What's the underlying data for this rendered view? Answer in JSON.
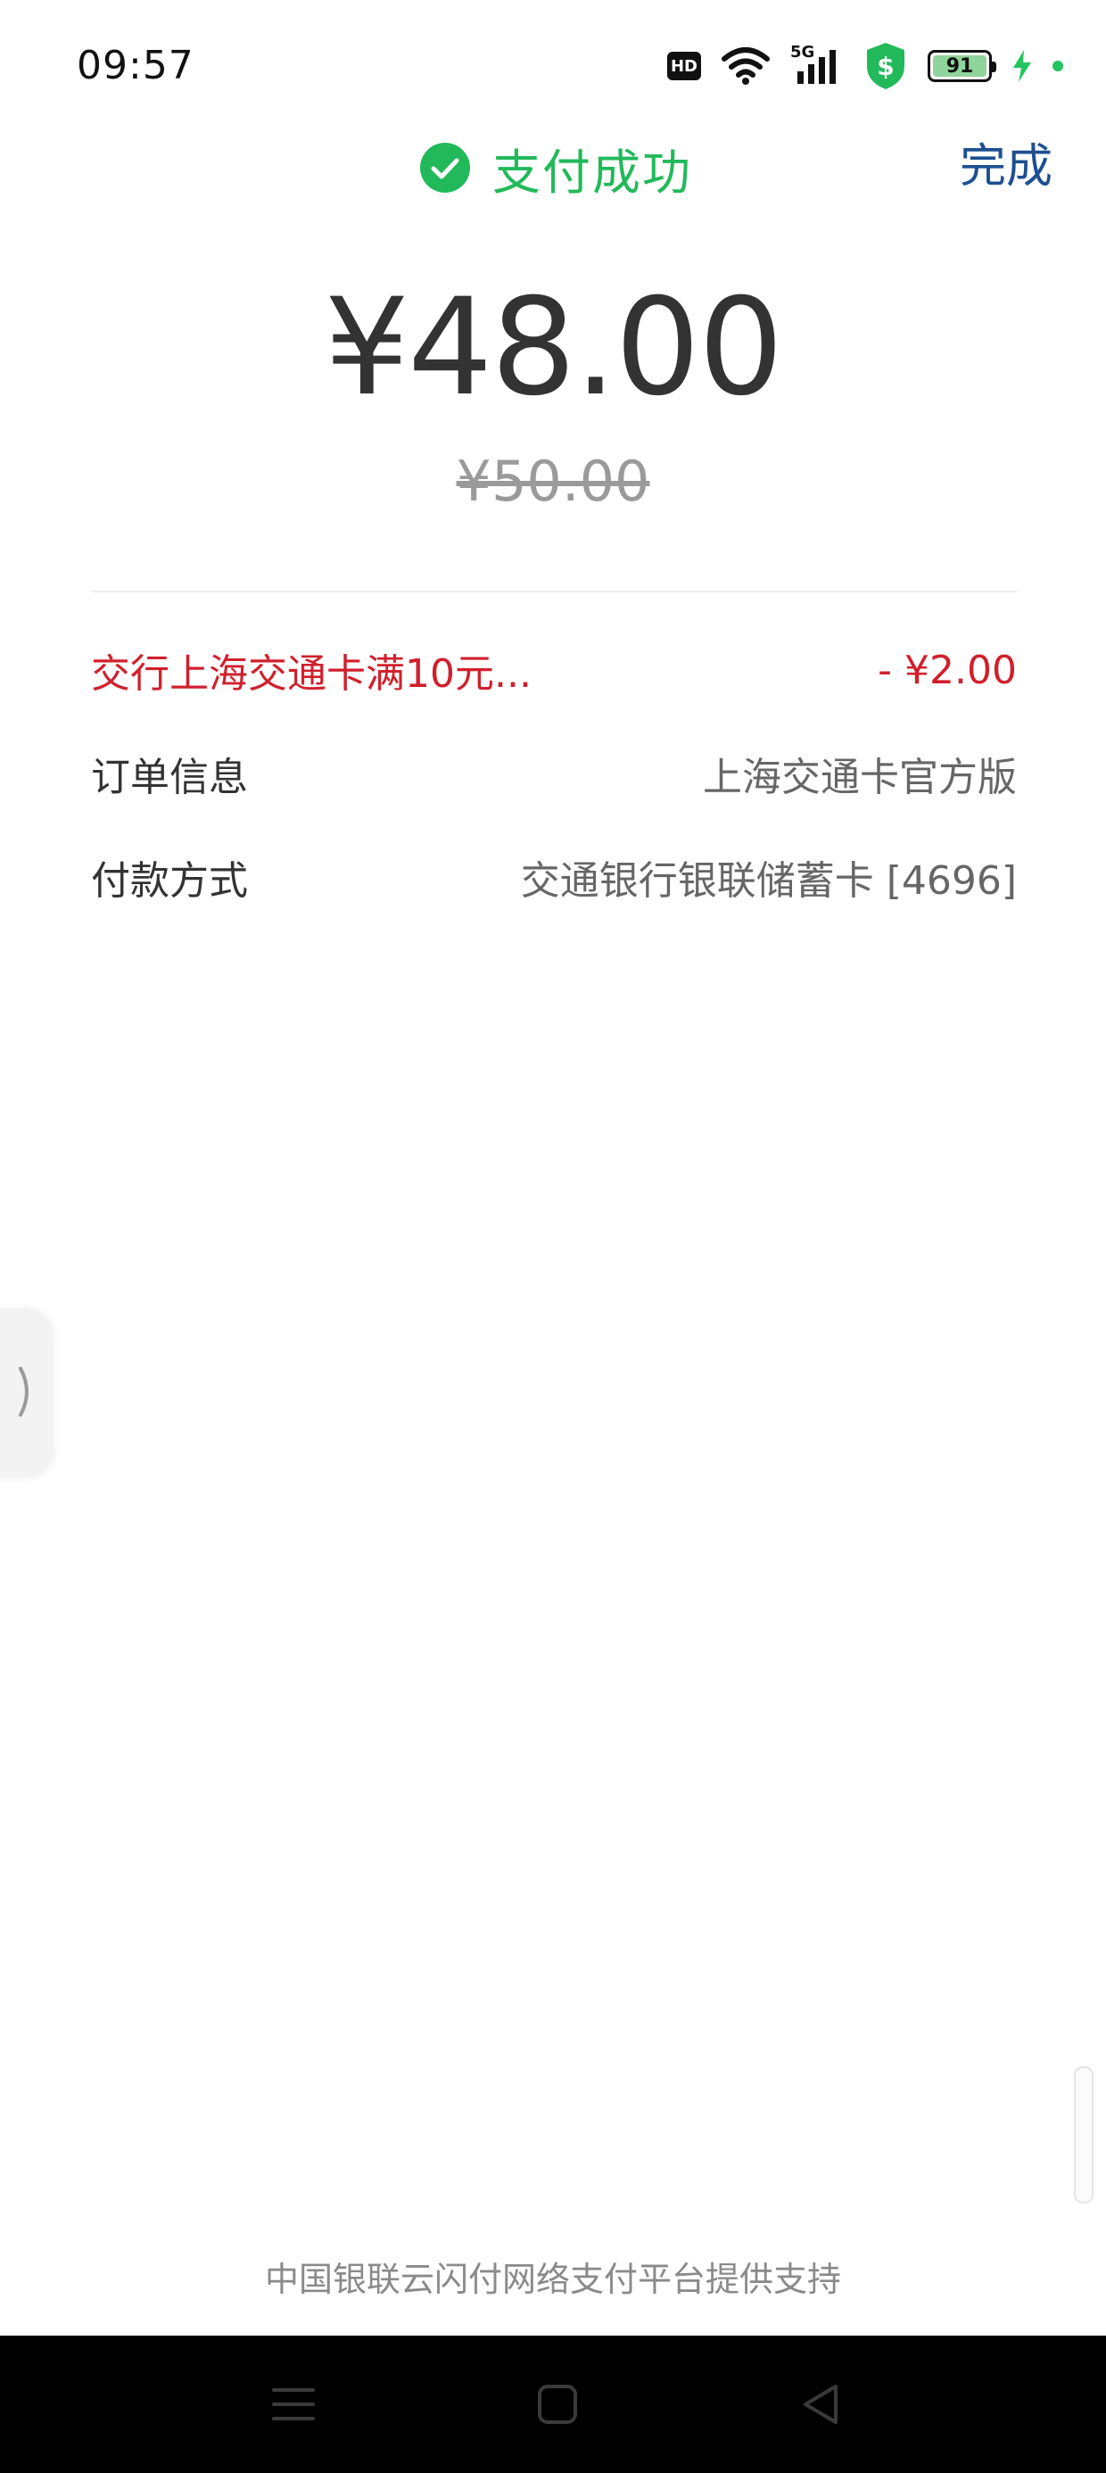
{
  "status_bar": {
    "time": "09:57",
    "hd_label": "HD",
    "network_label": "5G",
    "battery_level": "91"
  },
  "header": {
    "title": "支付成功",
    "done_label": "完成",
    "accent_color": "#22b95a",
    "link_color": "#1d4f91"
  },
  "payment": {
    "paid_amount": "¥48.00",
    "original_amount": "¥50.00"
  },
  "details": {
    "discount": {
      "label": "交行上海交通卡满10元...",
      "value": "- ¥2.00",
      "color": "#d0202c"
    },
    "order_info": {
      "label": "订单信息",
      "value": "上海交通卡官方版"
    },
    "payment_method": {
      "label": "付款方式",
      "value": "交通银行银联储蓄卡 [4696]"
    }
  },
  "footer": {
    "note": "中国银联云闪付网络支付平台提供支持"
  },
  "icons": {
    "success": "check-circle-icon",
    "side_handle": "chevron-right-icon",
    "nav_menu": "menu-icon",
    "nav_home": "home-square-icon",
    "nav_back": "back-triangle-icon"
  }
}
